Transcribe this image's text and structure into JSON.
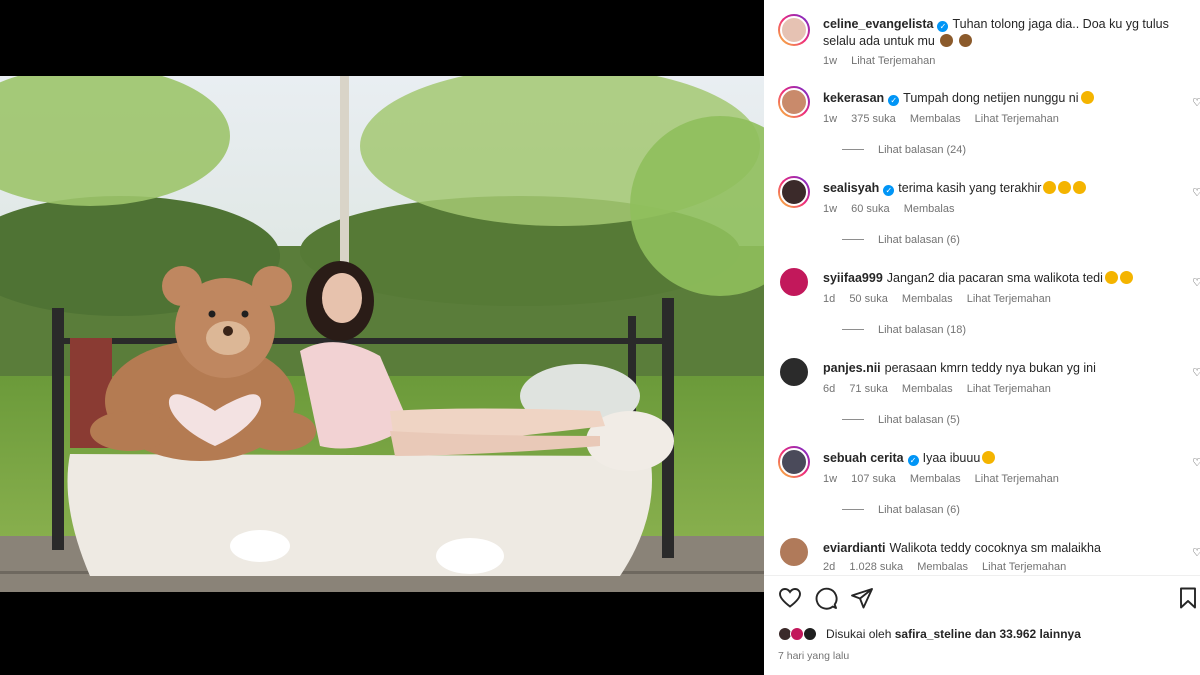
{
  "post": {
    "author": "celine_evangelista",
    "caption": "Tuhan tolong jaga dia.. Doa ku yg tulus selalu ada untuk mu",
    "time": "1w",
    "translate": "Lihat Terjemahan"
  },
  "comments": [
    {
      "user": "kekerasan",
      "verified": true,
      "text": "Tumpah dong netijen nunggu ni",
      "time": "1w",
      "likes": "375 suka",
      "reply": "Membalas",
      "translate": "Lihat Terjemahan",
      "view_replies": "Lihat balasan (24)",
      "avatar_color": "#c98a6b"
    },
    {
      "user": "sealisyah",
      "verified": true,
      "text": "terima kasih yang terakhir",
      "time": "1w",
      "likes": "60 suka",
      "reply": "Membalas",
      "translate": "",
      "view_replies": "Lihat balasan (6)",
      "avatar_color": "#3b2a2a"
    },
    {
      "user": "syiifaa999",
      "verified": false,
      "text": "Jangan2 dia pacaran sma walikota tedi",
      "time": "1d",
      "likes": "50 suka",
      "reply": "Membalas",
      "translate": "Lihat Terjemahan",
      "view_replies": "Lihat balasan (18)",
      "avatar_color": "#c2185b"
    },
    {
      "user": "panjes.nii",
      "verified": false,
      "text": "perasaan kmrn teddy nya bukan yg ini",
      "time": "6d",
      "likes": "71 suka",
      "reply": "Membalas",
      "translate": "Lihat Terjemahan",
      "view_replies": "Lihat balasan (5)",
      "avatar_color": "#2b2b2b"
    },
    {
      "user": "sebuah cerita",
      "verified": true,
      "text": "Iyaa ibuuu",
      "time": "1w",
      "likes": "107 suka",
      "reply": "Membalas",
      "translate": "Lihat Terjemahan",
      "view_replies": "Lihat balasan (6)",
      "avatar_color": "#4a4a5a"
    },
    {
      "user": "eviardianti",
      "verified": false,
      "text": "Walikota teddy cocoknya sm malaikha",
      "time": "2d",
      "likes": "1.028 suka",
      "reply": "Membalas",
      "translate": "Lihat Terjemahan",
      "view_replies": "",
      "avatar_color": "#b07a5a"
    }
  ],
  "likes_line": {
    "prefix": "Disukai oleh",
    "user": "safira_steline",
    "suffix": "dan 33.962 lainnya"
  },
  "date": "7 hari yang lalu",
  "icons": [
    "heart-icon",
    "comment-icon",
    "share-icon",
    "bookmark-icon",
    "verified-icon"
  ]
}
